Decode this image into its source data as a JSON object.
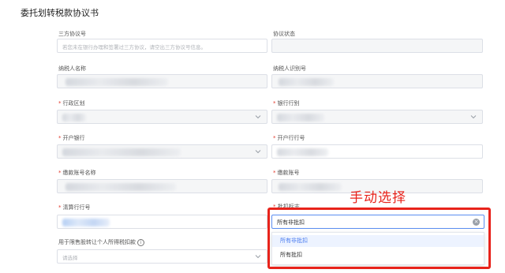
{
  "page": {
    "title": "委托划转税款协议书"
  },
  "form": {
    "tripartite_no": {
      "label": "三方协议号",
      "placeholder": "若您未在银行办理和签署过三方协议，请空出三方协议号信息。"
    },
    "agreement_status": {
      "label": "协议状态"
    },
    "taxpayer_name": {
      "label": "纳税人名称"
    },
    "taxpayer_id": {
      "label": "纳税人识别号"
    },
    "admin_region": {
      "label": "行政区划",
      "required": "*"
    },
    "bank_type": {
      "label": "银行行别",
      "required": "*"
    },
    "open_bank": {
      "label": "开户银行",
      "required": "*"
    },
    "open_bank_no": {
      "label": "开户行行号",
      "required": "*"
    },
    "payer_account_name": {
      "label": "缴款账号名称",
      "required": "*"
    },
    "payer_account_no": {
      "label": "缴款账号",
      "required": "*"
    },
    "clearing_bank_no": {
      "label": "清算行行号",
      "required": "*"
    },
    "batch_flag": {
      "label": "批扣标志",
      "required": "*",
      "value": "所有非批扣",
      "clear_icon": "×",
      "options": [
        "所有非批扣",
        "所有批扣"
      ],
      "selected_index": 0
    },
    "restricted_share": {
      "label": "用于限售股转让个人所得税扣款",
      "placeholder": "请选择",
      "info_icon": "i"
    }
  },
  "annotation": {
    "text": "手动选择",
    "color": "#e8231b"
  }
}
